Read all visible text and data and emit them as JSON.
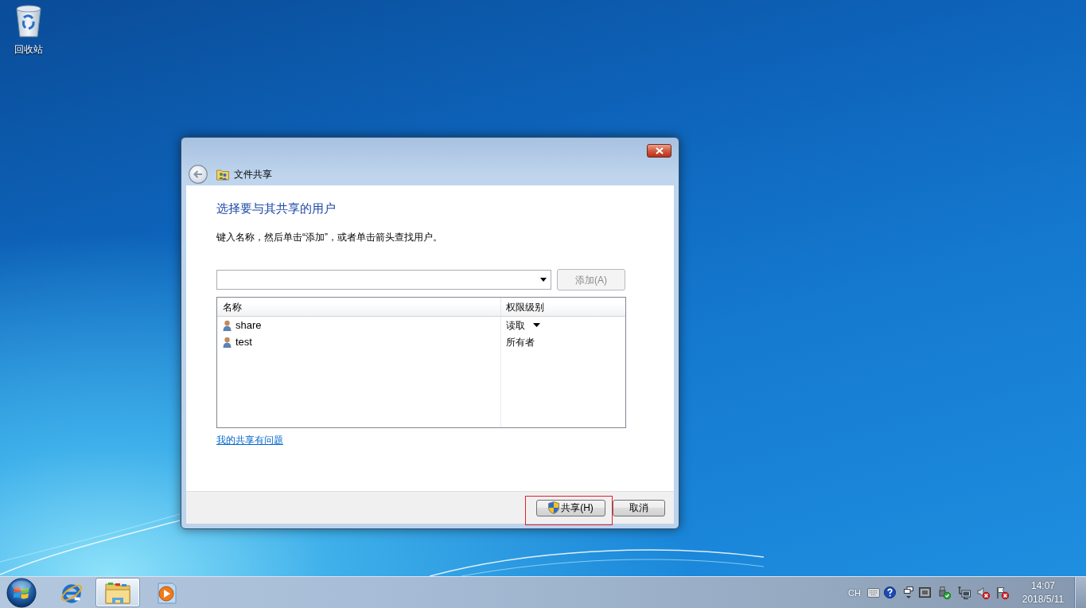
{
  "desktop": {
    "icons": [
      {
        "kind": "recycle-bin",
        "label": "回收站"
      }
    ]
  },
  "dialog": {
    "title": "文件共享",
    "heading": "选择要与其共享的用户",
    "instruction": "键入名称，然后单击“添加”，或者单击箭头查找用户。",
    "add_button": {
      "label": "添加(A)",
      "disabled": true
    },
    "user_list": {
      "columns": [
        "名称",
        "权限级别"
      ],
      "rows": [
        {
          "name": "share",
          "permission": "读取",
          "has_dropdown": true
        },
        {
          "name": "test",
          "permission": "所有者",
          "has_dropdown": false
        }
      ]
    },
    "help_link": "我的共享有问题",
    "buttons": [
      {
        "label": "共享(H)",
        "kind": "elevated",
        "highlighted": true
      },
      {
        "label": "取消",
        "kind": "plain",
        "highlighted": false
      }
    ]
  },
  "taskbar": {
    "pinned": [
      {
        "kind": "browser",
        "selected": false
      },
      {
        "kind": "file-manager",
        "selected": true
      },
      {
        "kind": "media-player",
        "selected": false
      }
    ],
    "tray": {
      "language": "CH",
      "time": "14:07",
      "date": "2018/5/11"
    }
  }
}
